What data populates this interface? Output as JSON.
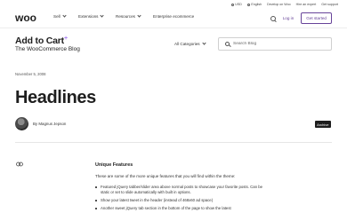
{
  "utility": {
    "currency": "USD",
    "language": "English",
    "links": [
      "Develop on Woo",
      "Hire an expert",
      "Get support"
    ]
  },
  "header": {
    "logo_text": "woo",
    "nav": [
      {
        "label": "Sell"
      },
      {
        "label": "Extensions"
      },
      {
        "label": "Resources"
      },
      {
        "label": "Enterprise ecommerce"
      }
    ],
    "login_label": "Log in",
    "get_started_label": "Get started"
  },
  "blog": {
    "title": "Add to Cart",
    "title_mark": "+",
    "subtitle": "The WooCommerce Blog",
    "category_select": "All Categories",
    "search_placeholder": "Search Blog"
  },
  "post": {
    "date": "November 5, 2008",
    "title": "Headlines",
    "author": "By Magnus Jepson",
    "badge": "Archive",
    "section_title": "Unique Features",
    "intro": "These are some of the more unique features that you will find within the theme:",
    "features": [
      "Featured jQuery tabber/slider area above normal posts to showcase your favorite posts. Can be static or set to slide automatically with built in options.",
      "Show your latest tweet in the header (instead of 468x60 ad space)",
      "Another sweet jQuery tab section in the bottom of the page to show the latest"
    ]
  },
  "colors": {
    "brand_purple": "#674399",
    "accent_lilac": "#a77ef2",
    "text_dark": "#1e1e1e"
  }
}
